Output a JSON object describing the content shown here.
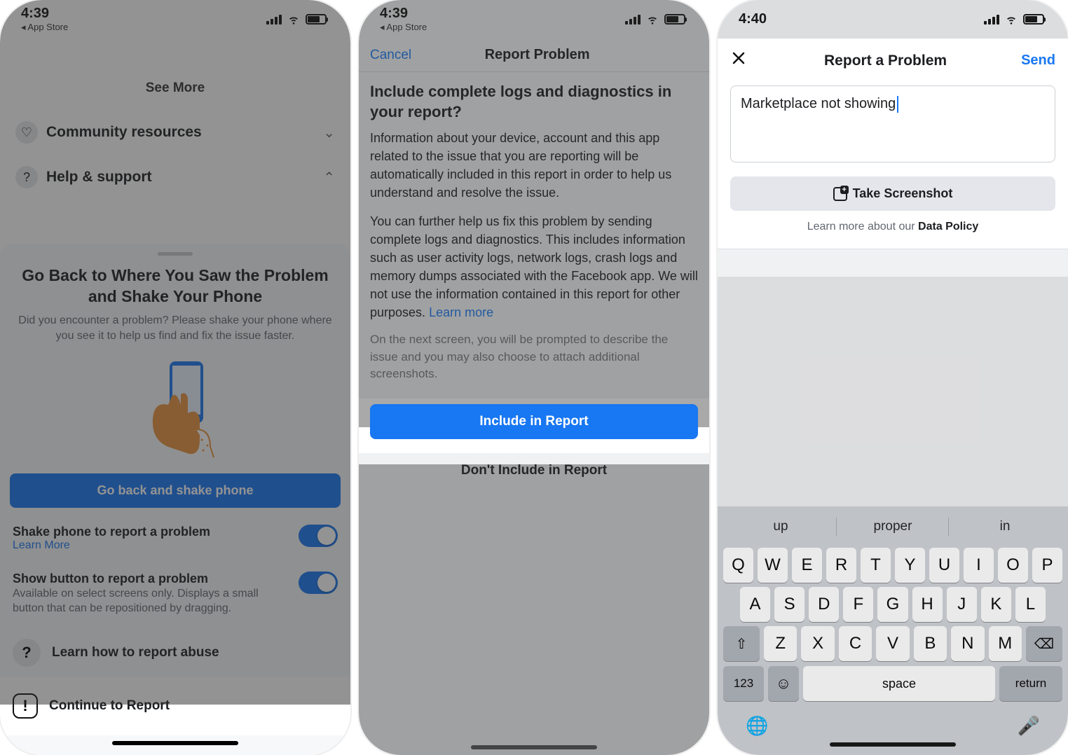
{
  "phone1": {
    "status": {
      "time": "4:39",
      "sublabel": "◂ App Store"
    },
    "bg": {
      "see_more": "See More",
      "row1": "Community resources",
      "row2": "Help & support"
    },
    "sheet": {
      "title": "Go Back to Where You Saw the Problem and Shake Your Phone",
      "subtitle": "Did you encounter a problem? Please shake your phone where you see it to help us find and fix the issue faster.",
      "primary_btn": "Go back and shake phone",
      "toggle1_title": "Shake phone to report a problem",
      "toggle1_link": "Learn More",
      "toggle2_title": "Show button to report a problem",
      "toggle2_desc": "Available on select screens only. Displays a small button that can be repositioned by dragging.",
      "learn_abuse": "Learn how to report abuse",
      "continue": "Continue to Report"
    }
  },
  "phone2": {
    "status": {
      "time": "4:39",
      "sublabel": "◂ App Store"
    },
    "header": {
      "cancel": "Cancel",
      "title": "Report Problem"
    },
    "body": {
      "heading": "Include complete logs and diagnostics in your report?",
      "para1": "Information about your device, account and this app related to the issue that you are reporting will be automatically included in this report in order to help us understand and resolve the issue.",
      "para2": "You can further help us fix this problem by sending complete logs and diagnostics. This includes information such as user activity logs, network logs, crash logs and memory dumps associated with the Facebook app. We will not use the information contained in this report for other purposes. ",
      "learn_more": "Learn more",
      "para3": "On the next screen, you will be prompted to describe the issue and you may also choose to attach additional screenshots.",
      "include_btn": "Include in Report",
      "dont_include_btn": "Don't Include in Report"
    }
  },
  "phone3": {
    "status": {
      "time": "4:40"
    },
    "header": {
      "title": "Report a Problem",
      "send": "Send"
    },
    "body": {
      "text_value": "Marketplace not showing",
      "screenshot_btn": "Take Screenshot",
      "policy_pre": "Learn more about our ",
      "policy_link": "Data Policy"
    },
    "keyboard": {
      "suggestions": [
        "up",
        "proper",
        "in"
      ],
      "row1": [
        "Q",
        "W",
        "E",
        "R",
        "T",
        "Y",
        "U",
        "I",
        "O",
        "P"
      ],
      "row2": [
        "A",
        "S",
        "D",
        "F",
        "G",
        "H",
        "J",
        "K",
        "L"
      ],
      "row3": [
        "Z",
        "X",
        "C",
        "V",
        "B",
        "N",
        "M"
      ],
      "shift_label": "⇧",
      "del_label": "⌫",
      "numbers": "123",
      "emoji": "☺",
      "space": "space",
      "return": "return",
      "globe": "🌐",
      "mic": "🎤"
    }
  }
}
